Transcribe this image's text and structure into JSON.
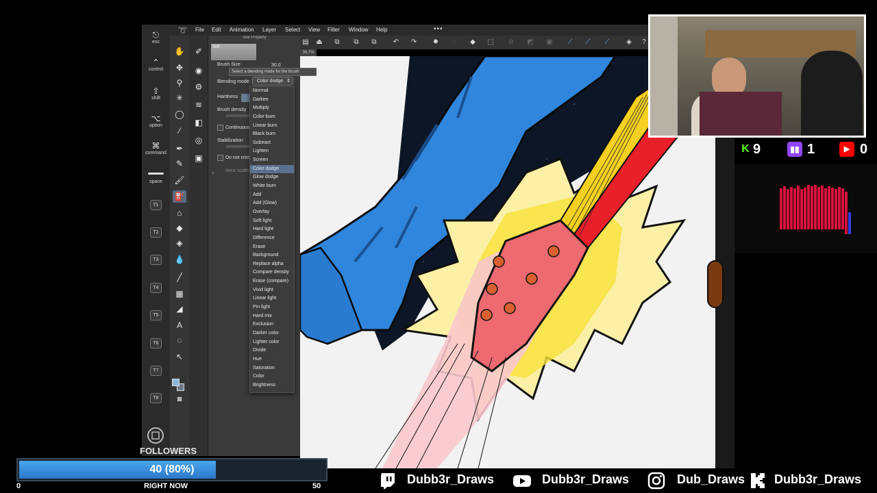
{
  "shortcut_keys": [
    {
      "label": "esc",
      "icon": "esc-icon"
    },
    {
      "label": "control",
      "icon": "control-icon"
    },
    {
      "label": "shift",
      "icon": "shift-icon"
    },
    {
      "label": "option",
      "icon": "option-icon"
    },
    {
      "label": "command",
      "icon": "command-icon"
    },
    {
      "label": "space",
      "icon": "space-bar-icon"
    }
  ],
  "tab_buttons": [
    "T1",
    "T2",
    "T3",
    "T4",
    "T5",
    "T6",
    "T7",
    "T8"
  ],
  "menu": {
    "items": [
      "File",
      "Edit",
      "Animation",
      "Layer",
      "Select",
      "Filter",
      "View",
      "Window",
      "Help"
    ],
    "more": "•••"
  },
  "tool_property": {
    "header": "Tool Property",
    "preset_name": "Soft",
    "brush_size_label": "Brush Size",
    "brush_size_value": "30.0",
    "tooltip": "Select a blending mode for the brush",
    "blending_mode_label": "Blending mode",
    "blending_mode_value": "Color dodge",
    "hardness_label": "Hardness",
    "brush_density_label": "Brush density",
    "continuous_label": "Continuous",
    "stabilization_label": "Stabilization",
    "do_not_cross_label": "Do not cross",
    "area_scaling_label": "Area scaling"
  },
  "blend_modes": [
    "Normal",
    "Darken",
    "Multiply",
    "Color burn",
    "Linear burn",
    "Black burn",
    "Subtract",
    "Lighten",
    "Screen",
    "Color dodge",
    "Glow dodge",
    "White burn",
    "Add",
    "Add (Glow)",
    "Overlay",
    "Soft light",
    "Hard light",
    "Difference",
    "Erase",
    "Background",
    "Replace alpha",
    "Compare density",
    "Erase (compare)",
    "Vivid light",
    "Linear light",
    "Pin light",
    "Hard mix",
    "Exclusion",
    "Darker color",
    "Lighter color",
    "Divide",
    "Hue",
    "Saturation",
    "Color",
    "Brightness"
  ],
  "selected_blend_mode": "Color dodge",
  "zoom_readout": "36.7%",
  "counters": {
    "kick": {
      "value": "9",
      "color": "#53fc18"
    },
    "twitch": {
      "value": "1",
      "color": "#9146ff"
    },
    "youtube": {
      "value": "0",
      "color": "#ff0000"
    }
  },
  "followers_goal": {
    "title": "FOLLOWERS",
    "display": "40 (80%)",
    "current": 40,
    "target": 50,
    "percent": 80,
    "min_label": "0",
    "max_label": "50",
    "sub_label": "RIGHT NOW"
  },
  "socials": [
    {
      "platform": "twitch",
      "handle": "Dubb3r_Draws"
    },
    {
      "platform": "youtube",
      "handle": "Dubb3r_Draws"
    },
    {
      "platform": "instagram",
      "handle": "Dub_Draws"
    },
    {
      "platform": "kick",
      "handle": "Dubb3r_Draws"
    }
  ],
  "colors": {
    "accent_blue": "#4aa6f0",
    "selection": "#5a7090",
    "guitar_red": "#e8202a",
    "guitar_yellow": "#f4e020"
  }
}
